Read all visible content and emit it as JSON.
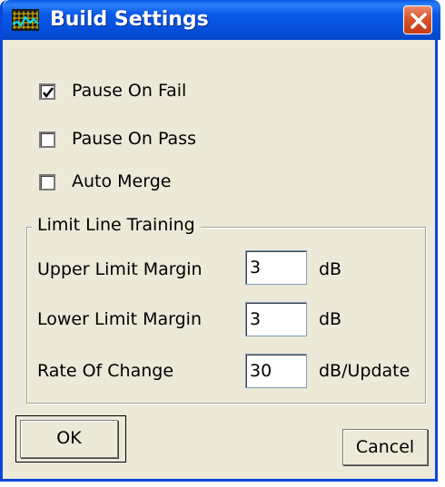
{
  "window": {
    "title": "Build Settings",
    "app_icon": "chart-grid-icon",
    "close_icon": "close-icon"
  },
  "options": [
    {
      "label": "Pause On Fail",
      "checked": true
    },
    {
      "label": "Pause On Pass",
      "checked": false
    },
    {
      "label": "Auto Merge",
      "checked": false
    }
  ],
  "group": {
    "title": "Limit Line Training",
    "fields": [
      {
        "label": "Upper Limit Margin",
        "value": "3",
        "unit": "dB"
      },
      {
        "label": "Lower Limit Margin",
        "value": "3",
        "unit": "dB"
      },
      {
        "label": "Rate Of Change",
        "value": "30",
        "unit": "dB/Update"
      }
    ]
  },
  "buttons": {
    "ok": "OK",
    "cancel": "Cancel"
  },
  "colors": {
    "titlebar": "#0a5ae8",
    "dialog_bg": "#ece9d8",
    "close_button": "#d9542c"
  }
}
